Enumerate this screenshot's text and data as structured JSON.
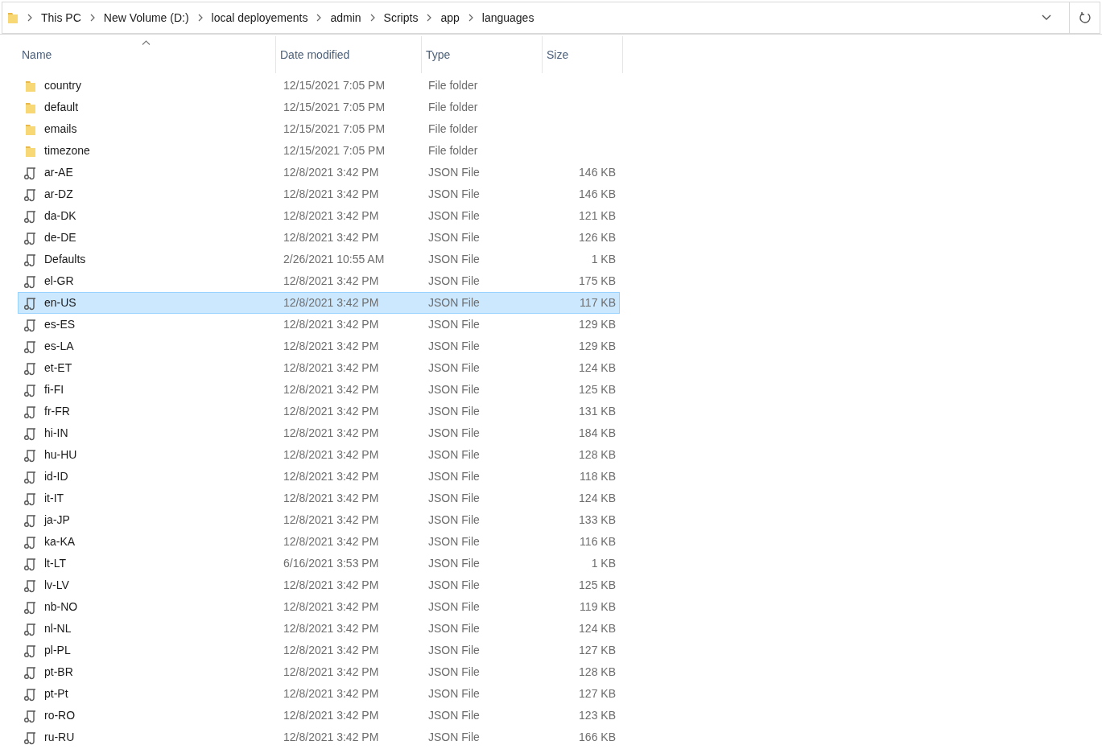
{
  "breadcrumbs": [
    "This PC",
    "New Volume (D:)",
    "local deployements",
    "admin",
    "Scripts",
    "app",
    "languages"
  ],
  "columns": [
    "Name",
    "Date modified",
    "Type",
    "Size"
  ],
  "files": [
    {
      "name": "country",
      "date": "12/15/2021 7:05 PM",
      "type": "File folder",
      "kind": "folder",
      "selected": false
    },
    {
      "name": "default",
      "date": "12/15/2021 7:05 PM",
      "type": "File folder",
      "kind": "folder",
      "selected": false
    },
    {
      "name": "emails",
      "date": "12/15/2021 7:05 PM",
      "type": "File folder",
      "kind": "folder",
      "selected": false
    },
    {
      "name": "timezone",
      "date": "12/15/2021 7:05 PM",
      "type": "File folder",
      "kind": "folder",
      "selected": false
    },
    {
      "name": "ar-AE",
      "date": "12/8/2021 3:42 PM",
      "type": "JSON File",
      "size": "146 KB",
      "kind": "json",
      "selected": false
    },
    {
      "name": "ar-DZ",
      "date": "12/8/2021 3:42 PM",
      "type": "JSON File",
      "size": "146 KB",
      "kind": "json",
      "selected": false
    },
    {
      "name": "da-DK",
      "date": "12/8/2021 3:42 PM",
      "type": "JSON File",
      "size": "121 KB",
      "kind": "json",
      "selected": false
    },
    {
      "name": "de-DE",
      "date": "12/8/2021 3:42 PM",
      "type": "JSON File",
      "size": "126 KB",
      "kind": "json",
      "selected": false
    },
    {
      "name": "Defaults",
      "date": "2/26/2021 10:55 AM",
      "type": "JSON File",
      "size": "1 KB",
      "kind": "json",
      "selected": false
    },
    {
      "name": "el-GR",
      "date": "12/8/2021 3:42 PM",
      "type": "JSON File",
      "size": "175 KB",
      "kind": "json",
      "selected": false
    },
    {
      "name": "en-US",
      "date": "12/8/2021 3:42 PM",
      "type": "JSON File",
      "size": "117 KB",
      "kind": "json",
      "selected": true
    },
    {
      "name": "es-ES",
      "date": "12/8/2021 3:42 PM",
      "type": "JSON File",
      "size": "129 KB",
      "kind": "json",
      "selected": false
    },
    {
      "name": "es-LA",
      "date": "12/8/2021 3:42 PM",
      "type": "JSON File",
      "size": "129 KB",
      "kind": "json",
      "selected": false
    },
    {
      "name": "et-ET",
      "date": "12/8/2021 3:42 PM",
      "type": "JSON File",
      "size": "124 KB",
      "kind": "json",
      "selected": false
    },
    {
      "name": "fi-FI",
      "date": "12/8/2021 3:42 PM",
      "type": "JSON File",
      "size": "125 KB",
      "kind": "json",
      "selected": false
    },
    {
      "name": "fr-FR",
      "date": "12/8/2021 3:42 PM",
      "type": "JSON File",
      "size": "131 KB",
      "kind": "json",
      "selected": false
    },
    {
      "name": "hi-IN",
      "date": "12/8/2021 3:42 PM",
      "type": "JSON File",
      "size": "184 KB",
      "kind": "json",
      "selected": false
    },
    {
      "name": "hu-HU",
      "date": "12/8/2021 3:42 PM",
      "type": "JSON File",
      "size": "128 KB",
      "kind": "json",
      "selected": false
    },
    {
      "name": "id-ID",
      "date": "12/8/2021 3:42 PM",
      "type": "JSON File",
      "size": "118 KB",
      "kind": "json",
      "selected": false
    },
    {
      "name": "it-IT",
      "date": "12/8/2021 3:42 PM",
      "type": "JSON File",
      "size": "124 KB",
      "kind": "json",
      "selected": false
    },
    {
      "name": "ja-JP",
      "date": "12/8/2021 3:42 PM",
      "type": "JSON File",
      "size": "133 KB",
      "kind": "json",
      "selected": false
    },
    {
      "name": "ka-KA",
      "date": "12/8/2021 3:42 PM",
      "type": "JSON File",
      "size": "116 KB",
      "kind": "json",
      "selected": false
    },
    {
      "name": "lt-LT",
      "date": "6/16/2021 3:53 PM",
      "type": "JSON File",
      "size": "1 KB",
      "kind": "json",
      "selected": false
    },
    {
      "name": "lv-LV",
      "date": "12/8/2021 3:42 PM",
      "type": "JSON File",
      "size": "125 KB",
      "kind": "json",
      "selected": false
    },
    {
      "name": "nb-NO",
      "date": "12/8/2021 3:42 PM",
      "type": "JSON File",
      "size": "119 KB",
      "kind": "json",
      "selected": false
    },
    {
      "name": "nl-NL",
      "date": "12/8/2021 3:42 PM",
      "type": "JSON File",
      "size": "124 KB",
      "kind": "json",
      "selected": false
    },
    {
      "name": "pl-PL",
      "date": "12/8/2021 3:42 PM",
      "type": "JSON File",
      "size": "127 KB",
      "kind": "json",
      "selected": false
    },
    {
      "name": "pt-BR",
      "date": "12/8/2021 3:42 PM",
      "type": "JSON File",
      "size": "128 KB",
      "kind": "json",
      "selected": false
    },
    {
      "name": "pt-Pt",
      "date": "12/8/2021 3:42 PM",
      "type": "JSON File",
      "size": "127 KB",
      "kind": "json",
      "selected": false
    },
    {
      "name": "ro-RO",
      "date": "12/8/2021 3:42 PM",
      "type": "JSON File",
      "size": "123 KB",
      "kind": "json",
      "selected": false
    },
    {
      "name": "ru-RU",
      "date": "12/8/2021 3:42 PM",
      "type": "JSON File",
      "size": "166 KB",
      "kind": "json",
      "selected": false
    }
  ]
}
